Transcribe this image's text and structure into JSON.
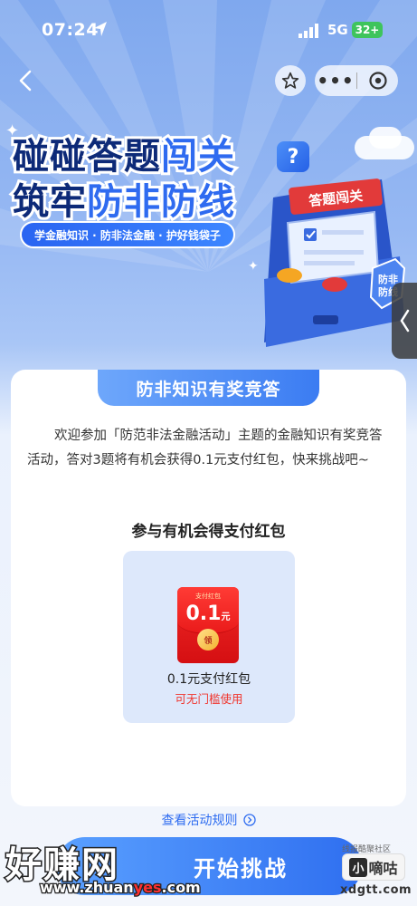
{
  "status_bar": {
    "time": "07:24",
    "network": "5G",
    "battery": "32+"
  },
  "banner": {
    "title_line1_a": "碰碰",
    "title_line1_b": "答题",
    "title_line1_c": "闯关",
    "title_line2_a": "筑牢",
    "title_line2_b": "防非防线",
    "tagline": "学金融知识 · 防非法金融 · 护好钱袋子",
    "machine_sign": "答题闯关",
    "shield_text": "防非\n防线"
  },
  "card": {
    "header": "防非知识有奖竞答",
    "intro": "欢迎参加「防范非法金融活动」主题的金融知识有奖竞答活动，答对3题将有机会获得0.1元支付红包，快来挑战吧~",
    "section_title": "参与有机会得支付红包",
    "prize": {
      "envelope_label": "支付红包",
      "amount": "0.1",
      "unit": "元",
      "coin_text": "领",
      "name": "0.1元支付红包",
      "note": "可无门槛使用"
    }
  },
  "rules_link": "查看活动规则",
  "start_button": "开始挑战",
  "watermarks": {
    "big": "好赚网",
    "url_a": "www.zhuan",
    "url_b": "yes",
    "url_c": ".com",
    "forum": "线报酷聚社区",
    "logo_x": "小",
    "logo": "嘀咕",
    "domain": "xdgtt.com"
  },
  "colors": {
    "primary": "#2f6ff0",
    "accent_red": "#f0352d",
    "title_navy": "#0d2a78"
  }
}
